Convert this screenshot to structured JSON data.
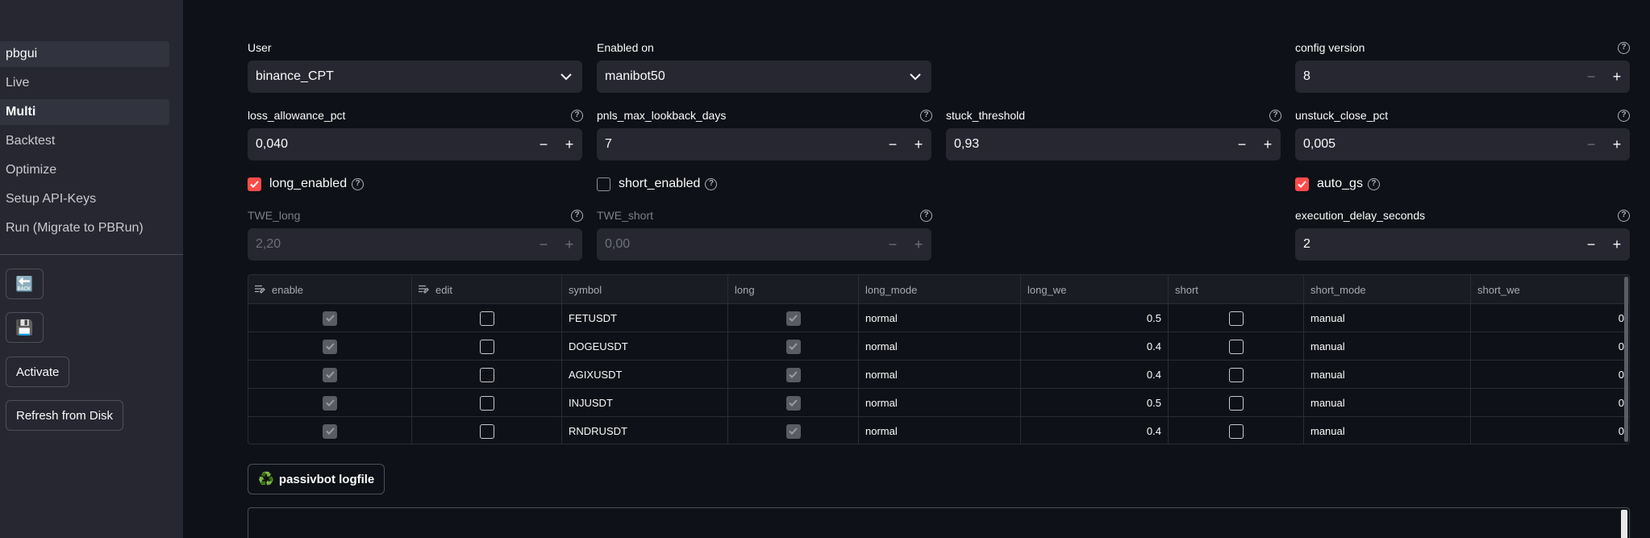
{
  "sidebar": {
    "items": [
      {
        "label": "pbgui"
      },
      {
        "label": "Live"
      },
      {
        "label": "Multi"
      },
      {
        "label": "Backtest"
      },
      {
        "label": "Optimize"
      },
      {
        "label": "Setup API-Keys"
      },
      {
        "label": "Run (Migrate to PBRun)"
      }
    ],
    "back_icon": "🔙",
    "save_icon": "💾",
    "activate_label": "Activate",
    "refresh_label": "Refresh from Disk"
  },
  "form": {
    "user": {
      "label": "User",
      "value": "binance_CPT"
    },
    "enabled_on": {
      "label": "Enabled on",
      "value": "manibot50"
    },
    "config_version": {
      "label": "config version",
      "value": "8"
    },
    "loss_allowance_pct": {
      "label": "loss_allowance_pct",
      "value": "0,040"
    },
    "pnls_max_lookback_days": {
      "label": "pnls_max_lookback_days",
      "value": "7"
    },
    "stuck_threshold": {
      "label": "stuck_threshold",
      "value": "0,93"
    },
    "unstuck_close_pct": {
      "label": "unstuck_close_pct",
      "value": "0,005"
    },
    "long_enabled": {
      "label": "long_enabled",
      "checked": true
    },
    "short_enabled": {
      "label": "short_enabled",
      "checked": false
    },
    "auto_gs": {
      "label": "auto_gs",
      "checked": true
    },
    "twe_long": {
      "label": "TWE_long",
      "value": "2,20"
    },
    "twe_short": {
      "label": "TWE_short",
      "value": "0,00"
    },
    "execution_delay_seconds": {
      "label": "execution_delay_seconds",
      "value": "2"
    },
    "minus": "−",
    "plus": "+",
    "help": "?"
  },
  "table": {
    "columns": [
      "enable",
      "edit",
      "symbol",
      "long",
      "long_mode",
      "long_we",
      "short",
      "short_mode",
      "short_we"
    ],
    "rows": [
      {
        "enable": true,
        "edit": false,
        "symbol": "FETUSDT",
        "long": true,
        "long_mode": "normal",
        "long_we": "0.5",
        "short": false,
        "short_mode": "manual",
        "short_we": "0"
      },
      {
        "enable": true,
        "edit": false,
        "symbol": "DOGEUSDT",
        "long": true,
        "long_mode": "normal",
        "long_we": "0.4",
        "short": false,
        "short_mode": "manual",
        "short_we": "0"
      },
      {
        "enable": true,
        "edit": false,
        "symbol": "AGIXUSDT",
        "long": true,
        "long_mode": "normal",
        "long_we": "0.4",
        "short": false,
        "short_mode": "manual",
        "short_we": "0"
      },
      {
        "enable": true,
        "edit": false,
        "symbol": "INJUSDT",
        "long": true,
        "long_mode": "normal",
        "long_we": "0.5",
        "short": false,
        "short_mode": "manual",
        "short_we": "0"
      },
      {
        "enable": true,
        "edit": false,
        "symbol": "RNDRUSDT",
        "long": true,
        "long_mode": "normal",
        "long_we": "0.4",
        "short": false,
        "short_mode": "manual",
        "short_we": "0"
      }
    ]
  },
  "log": {
    "button_icon": "♻️",
    "button_label": "passivbot logfile"
  },
  "colors": {
    "accent": "#ff4b4b",
    "sidebar_bg": "#262730",
    "main_bg": "#0e1117"
  }
}
